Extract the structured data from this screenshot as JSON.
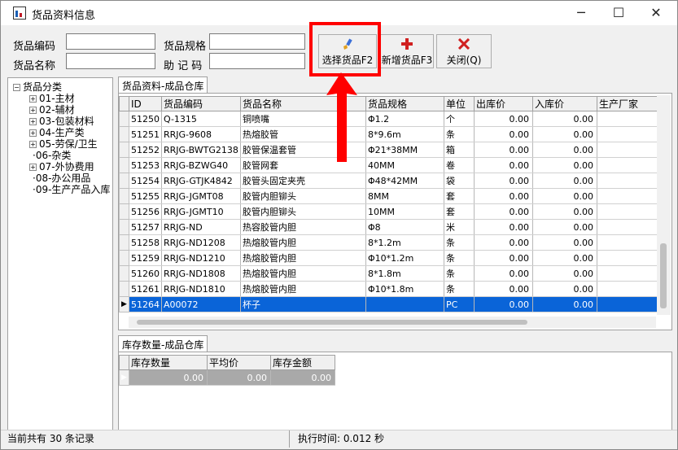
{
  "window": {
    "title": "货品资料信息",
    "min_glyph": "─",
    "max_glyph": "☐",
    "close_glyph": "✕"
  },
  "filters": {
    "code_label": "货品编码",
    "name_label": "货品名称",
    "spec_label": "货品规格",
    "mnemonic_label": "助 记 码",
    "code_value": "",
    "name_value": "",
    "spec_value": "",
    "mnemonic_value": ""
  },
  "toolbar": {
    "select_label": "选择货品F2",
    "add_label": "新增货品F3",
    "close_label": "关闭(Q)"
  },
  "tree": {
    "root": "货品分类",
    "items": [
      {
        "label": "01-主材",
        "expandable": true
      },
      {
        "label": "02-辅材",
        "expandable": true
      },
      {
        "label": "03-包装材料",
        "expandable": true
      },
      {
        "label": "04-生产类",
        "expandable": true
      },
      {
        "label": "05-劳保/卫生",
        "expandable": true
      },
      {
        "label": "06-杂类",
        "expandable": false
      },
      {
        "label": "07-外协费用",
        "expandable": true
      },
      {
        "label": "08-办公用品",
        "expandable": false
      },
      {
        "label": "09-生产产品入库",
        "expandable": false
      }
    ]
  },
  "goods_tab": "货品资料-成品仓库",
  "goods_table": {
    "headers": [
      "ID",
      "货品编码",
      "货品名称",
      "货品规格",
      "单位",
      "出库价",
      "入库价",
      "生产厂家"
    ],
    "rows": [
      [
        "51250",
        "Q-1315",
        "铜喷嘴",
        "Φ1.2",
        "个",
        "0.00",
        "0.00",
        ""
      ],
      [
        "51251",
        "RRJG-9608",
        "热熔胶管",
        "8*9.6m",
        "条",
        "0.00",
        "0.00",
        ""
      ],
      [
        "51252",
        "RRJG-BWTG2138",
        "胶管保温套管",
        "Φ21*38MM",
        "箱",
        "0.00",
        "0.00",
        ""
      ],
      [
        "51253",
        "RRJG-BZWG40",
        "胶管网套",
        "40MM",
        "卷",
        "0.00",
        "0.00",
        ""
      ],
      [
        "51254",
        "RRJG-GTJK4842",
        "胶管头固定夹壳",
        "Φ48*42MM",
        "袋",
        "0.00",
        "0.00",
        ""
      ],
      [
        "51255",
        "RRJG-JGMT08",
        "胶管内胆铆头",
        "8MM",
        "套",
        "0.00",
        "0.00",
        ""
      ],
      [
        "51256",
        "RRJG-JGMT10",
        "胶管内胆铆头",
        "10MM",
        "套",
        "0.00",
        "0.00",
        ""
      ],
      [
        "51257",
        "RRJG-ND",
        "热容胶管内胆",
        "Φ8",
        "米",
        "0.00",
        "0.00",
        ""
      ],
      [
        "51258",
        "RRJG-ND1208",
        "热熔胶管内胆",
        "8*1.2m",
        "条",
        "0.00",
        "0.00",
        ""
      ],
      [
        "51259",
        "RRJG-ND1210",
        "热熔胶管内胆",
        "Φ10*1.2m",
        "条",
        "0.00",
        "0.00",
        ""
      ],
      [
        "51260",
        "RRJG-ND1808",
        "热熔胶管内胆",
        "8*1.8m",
        "条",
        "0.00",
        "0.00",
        ""
      ],
      [
        "51261",
        "RRJG-ND1810",
        "热熔胶管内胆",
        "Φ10*1.8m",
        "条",
        "0.00",
        "0.00",
        ""
      ],
      [
        "51264",
        "A00072",
        "杯子",
        "",
        "PC",
        "0.00",
        "0.00",
        ""
      ]
    ],
    "selected_row": 12
  },
  "stock_tab": "库存数量-成品仓库",
  "stock_table": {
    "headers": [
      "库存数量",
      "平均价",
      "库存金额"
    ],
    "row": [
      "0.00",
      "0.00",
      "0.00"
    ]
  },
  "status": {
    "records": "当前共有 30 条记录",
    "exec_time": "执行时间: 0.012 秒"
  },
  "colors": {
    "selection": "#0a64d8",
    "highlight": "#ff0000"
  }
}
